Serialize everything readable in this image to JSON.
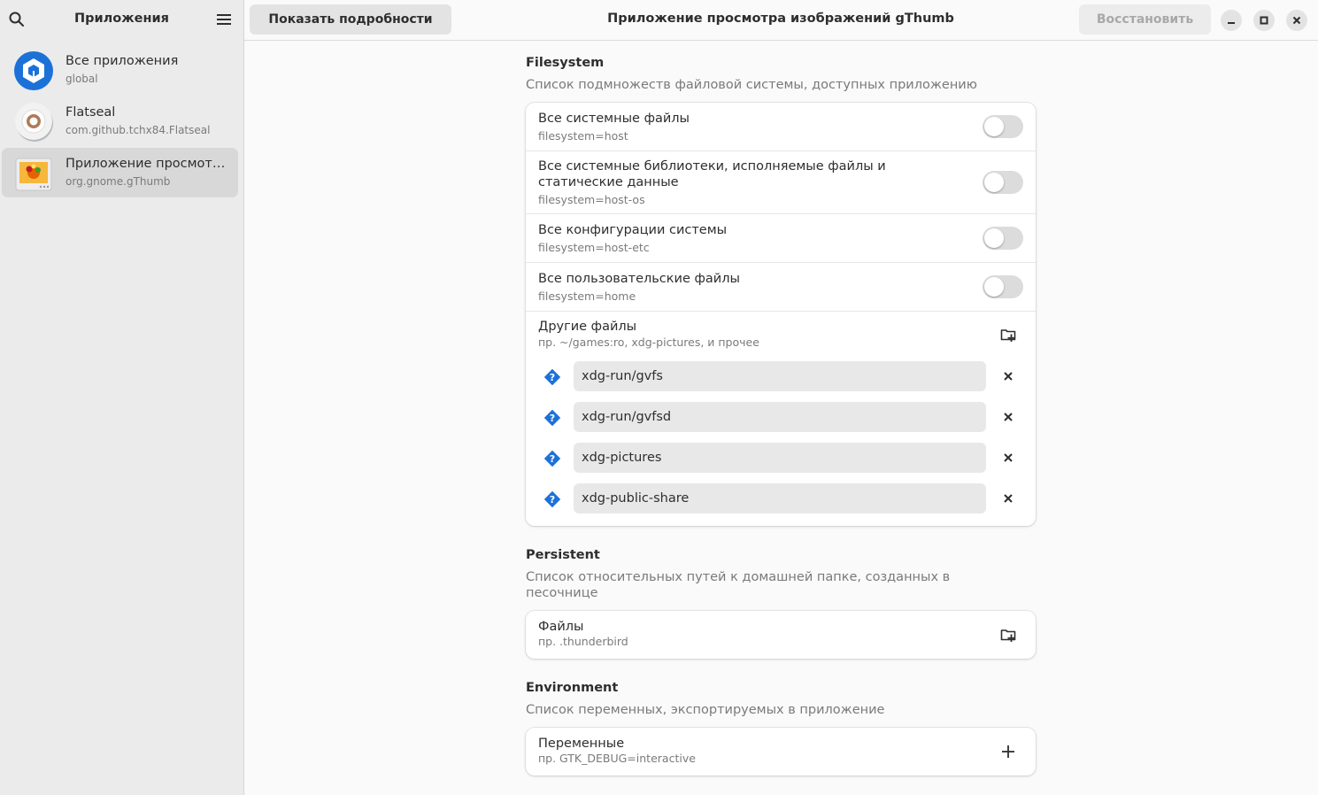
{
  "sidebar": {
    "title": "Приложения",
    "search_icon": "search-icon",
    "menu_icon": "hamburger-menu-icon",
    "apps": [
      {
        "name": "Все приложения",
        "id": "global",
        "icon": "flatpak-icon"
      },
      {
        "name": "Flatseal",
        "id": "com.github.tchx84.Flatseal",
        "icon": "flatseal-icon"
      },
      {
        "name": "Приложение просмотра изображений gThumb",
        "id": "org.gnome.gThumb",
        "icon": "gthumb-icon",
        "selected": true
      }
    ]
  },
  "header": {
    "details_button": "Показать подробности",
    "title": "Приложение просмотра изображений gThumb",
    "restore_button": "Восстановить"
  },
  "filesystem": {
    "title": "Filesystem",
    "description": "Список подмножеств файловой системы, доступных приложению",
    "toggles": [
      {
        "label": "Все системные файлы",
        "key": "filesystem=host",
        "enabled": false
      },
      {
        "label": "Все системные библиотеки, исполняемые файлы и статические данные",
        "key": "filesystem=host-os",
        "enabled": false
      },
      {
        "label": "Все конфигурации системы",
        "key": "filesystem=host-etc",
        "enabled": false
      },
      {
        "label": "Все пользовательские файлы",
        "key": "filesystem=home",
        "enabled": false
      }
    ],
    "other": {
      "label": "Другие файлы",
      "hint": "пр. ~/games:ro, xdg-pictures, и прочее",
      "paths": [
        "xdg-run/gvfs",
        "xdg-run/gvfsd",
        "xdg-pictures",
        "xdg-public-share"
      ]
    }
  },
  "persistent": {
    "title": "Persistent",
    "description": "Список относительных путей к домашней папке, созданных в песочнице",
    "label": "Файлы",
    "hint": "пр. .thunderbird"
  },
  "environment": {
    "title": "Environment",
    "description": "Список переменных, экспортируемых в приложение",
    "label": "Переменные",
    "hint": "пр. GTK_DEBUG=interactive"
  },
  "colors": {
    "accent": "#1c71d8",
    "toggle_off": "#dcdcdc",
    "sidebar_bg": "#ebebeb"
  }
}
